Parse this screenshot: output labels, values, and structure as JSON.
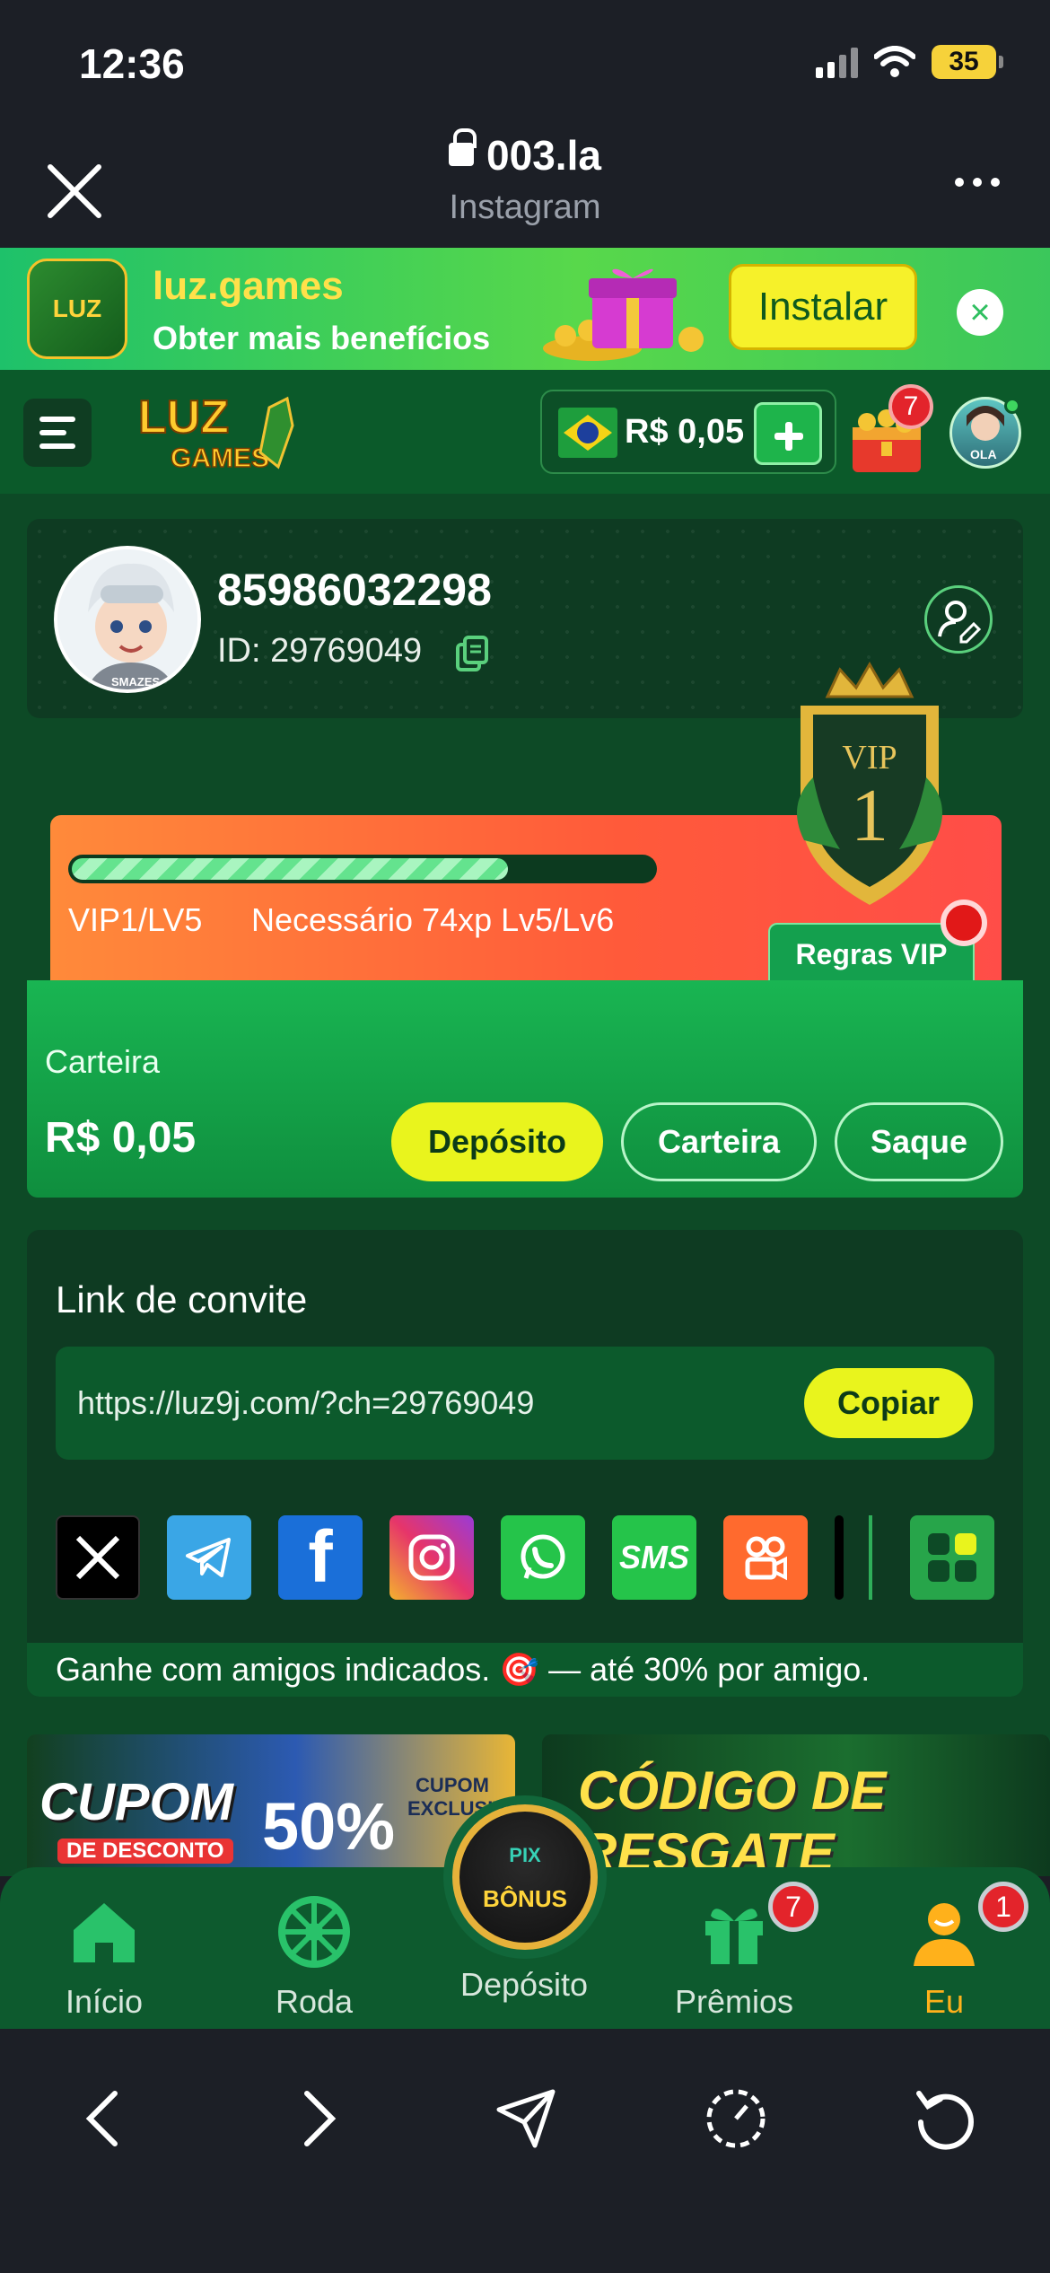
{
  "status_bar": {
    "time": "12:36",
    "battery": "35"
  },
  "browser": {
    "url": "003.la",
    "source": "Instagram"
  },
  "install_banner": {
    "logo_text": "LUZ",
    "title": "luz.games",
    "subtitle": "Obter mais benefícios",
    "button": "Instalar"
  },
  "header": {
    "logo_text": "LUZ",
    "logo_sub": "GAMES",
    "balance": "R$ 0,05",
    "chest_badge": "7",
    "avatar_text": "OLA"
  },
  "profile": {
    "username": "85986032298",
    "id_label": "ID: 29769049",
    "avatar_text": "SMAZES"
  },
  "vip": {
    "level": "VIP1/LV5",
    "needed": "Necessário 74xp Lv5/Lv6",
    "progress": 0.75,
    "rules_button": "Regras VIP",
    "badge_title": "VIP",
    "badge_num": "1"
  },
  "wallet": {
    "label": "Carteira",
    "amount": "R$ 0,05",
    "deposit": "Depósito",
    "wallet": "Carteira",
    "withdraw": "Saque"
  },
  "invite": {
    "title": "Link de convite",
    "url": "https://luz9j.com/?ch=29769049",
    "copy": "Copiar",
    "footer": "Ganhe com amigos indicados. 🎯 — até 30% por amigo.",
    "share_sms": "SMS",
    "share_facebook": "f"
  },
  "promos": {
    "coupon_title": "CUPOM",
    "coupon_sub": "DE DESCONTO",
    "coupon_pct": "50%",
    "coupon_exclusive": "CUPOM EXCLUSIVO",
    "code_title": "CÓDIGO DE RESGATE"
  },
  "tabs": {
    "home": "Início",
    "wheel": "Roda",
    "deposit": "Depósito",
    "prizes": "Prêmios",
    "me": "Eu",
    "prizes_badge": "7",
    "me_badge": "1",
    "center_pix": "PIX",
    "center_bonus": "BÔNUS"
  },
  "colors": {
    "brand_green": "#0d4a26",
    "accent_yellow": "#e9f41d",
    "vip_orange": "#ff5a3a",
    "active_tab": "#ffb11b"
  }
}
